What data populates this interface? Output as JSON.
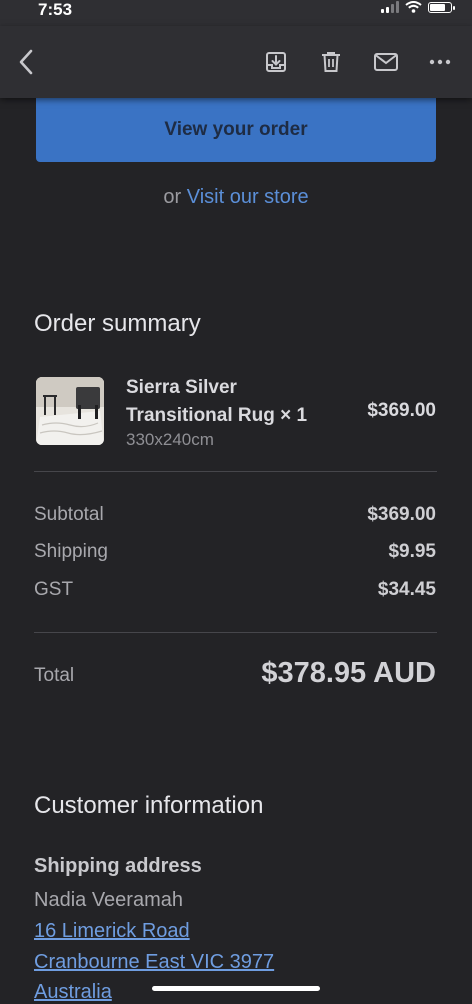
{
  "status_bar": {
    "time": "7:53"
  },
  "toolbar": {
    "back_icon": "chevron-left-icon",
    "archive_icon": "archive-icon",
    "delete_icon": "trash-icon",
    "mail_icon": "envelope-icon",
    "more_icon": "more-horizontal-icon"
  },
  "cta": {
    "label": "View your order"
  },
  "visit": {
    "prefix": "or",
    "link": "Visit our store"
  },
  "order_summary": {
    "title": "Order summary",
    "items": [
      {
        "name": "Sierra Silver Transitional Rug × 1",
        "variant": "330x240cm",
        "price": "$369.00"
      }
    ],
    "rows": [
      {
        "label": "Subtotal",
        "value": "$369.00"
      },
      {
        "label": "Shipping",
        "value": "$9.95"
      },
      {
        "label": "GST",
        "value": "$34.45"
      }
    ],
    "total_label": "Total",
    "total_value": "$378.95 AUD"
  },
  "customer": {
    "title": "Customer information",
    "shipping_label": "Shipping address",
    "name": "Nadia Veeramah",
    "address_lines": [
      "16 Limerick Road",
      "Cranbourne East VIC 3977",
      "Australia"
    ]
  },
  "colors": {
    "background": "#232326",
    "toolbar": "#2f2f33",
    "button": "#3a73c4",
    "link": "#5b8fd8"
  }
}
